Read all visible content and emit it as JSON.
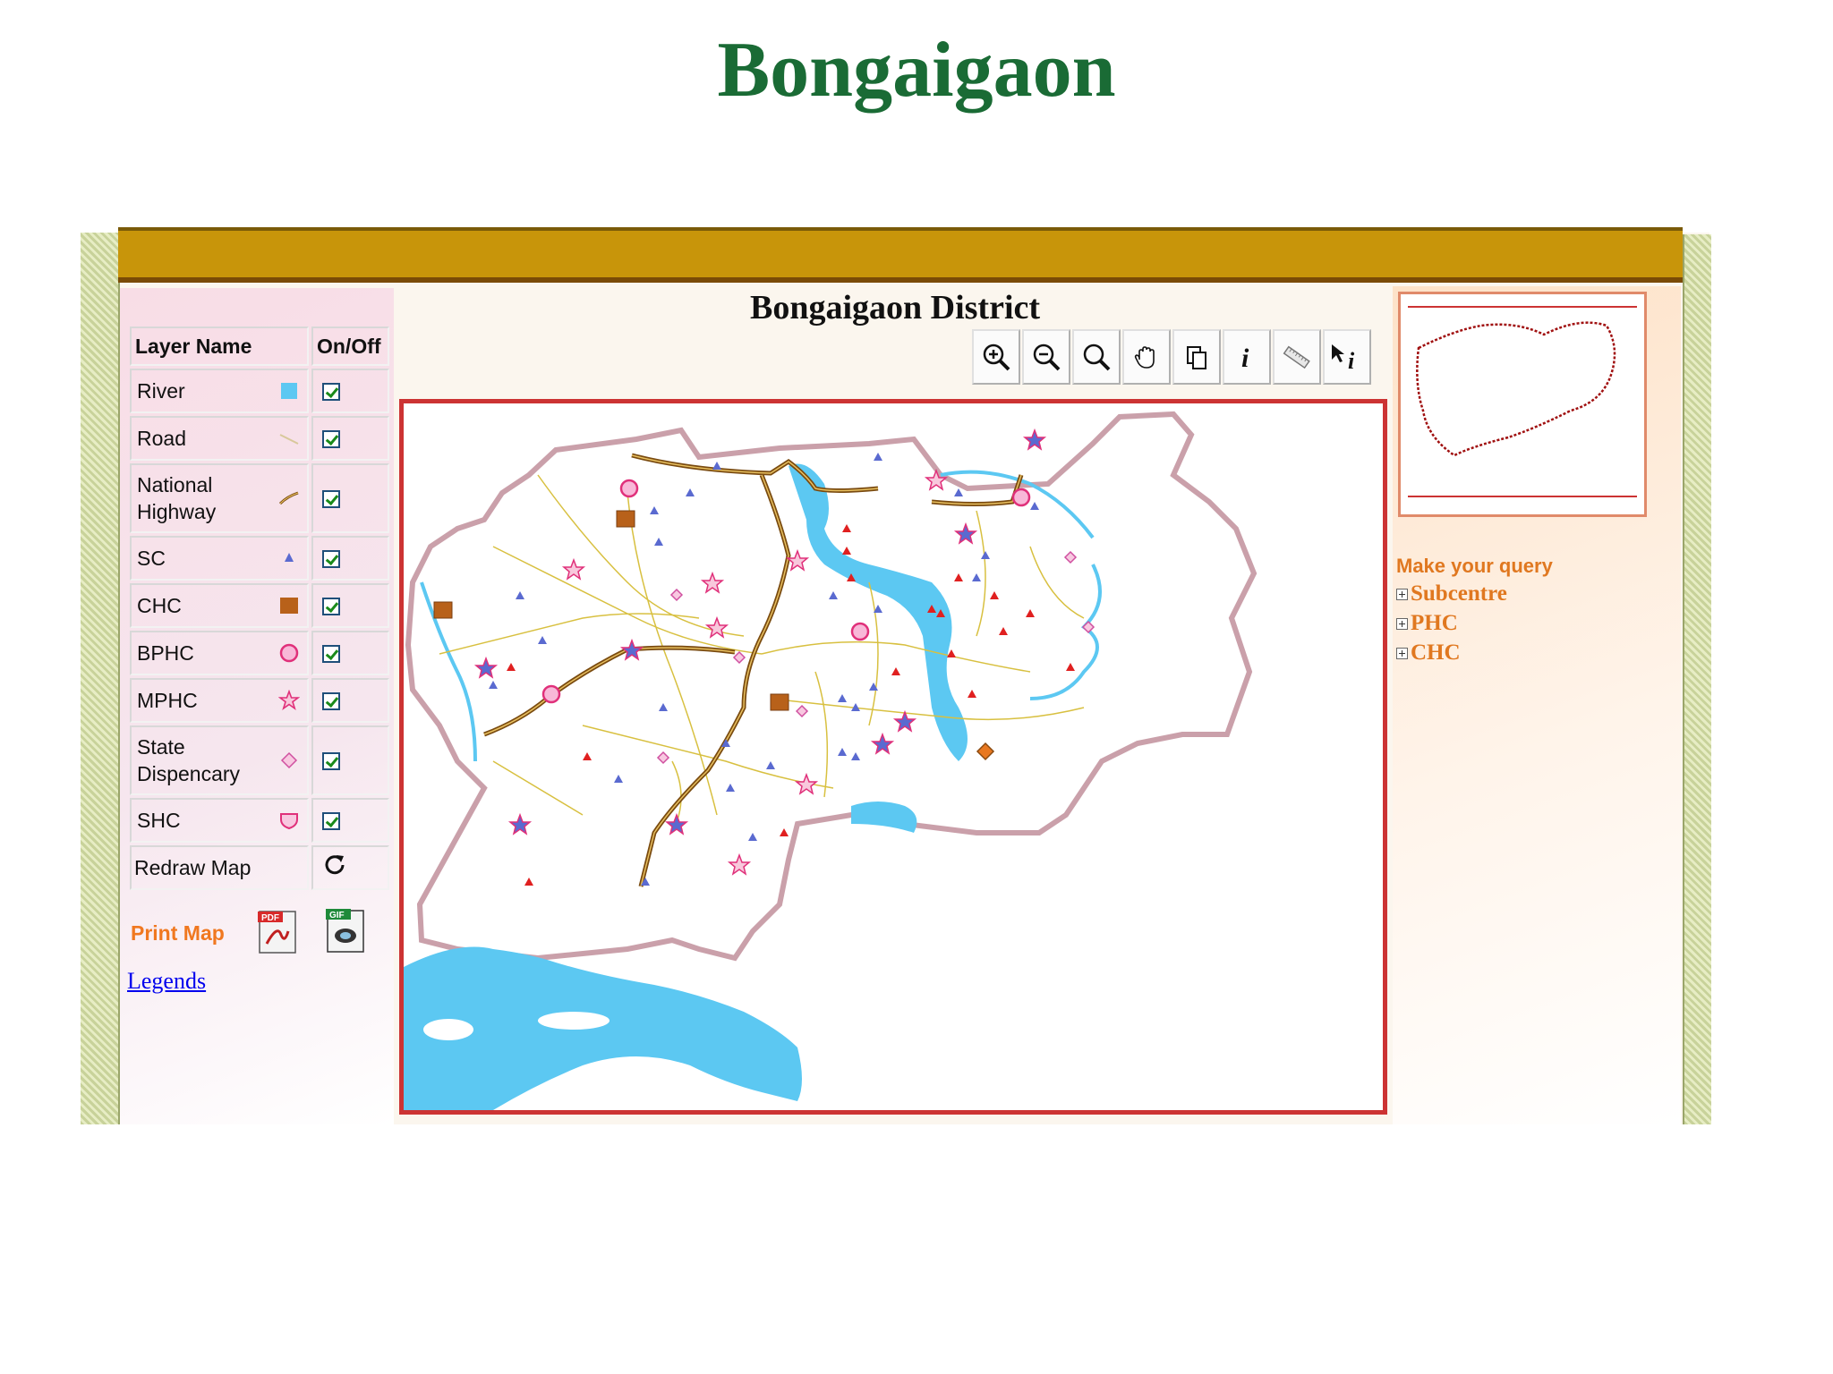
{
  "slide_title": "Bongaigaon",
  "map_title": "Bongaigaon District",
  "layer_table": {
    "header_name": "Layer Name",
    "header_toggle": "On/Off",
    "layers": [
      {
        "name": "River",
        "symbol": "river-swatch",
        "checked": true
      },
      {
        "name": "Road",
        "symbol": "road-line",
        "checked": true
      },
      {
        "name": "National Highway",
        "symbol": "highway-line",
        "checked": true
      },
      {
        "name": "SC",
        "symbol": "triangle",
        "checked": true
      },
      {
        "name": "CHC",
        "symbol": "brown-square",
        "checked": true
      },
      {
        "name": "BPHC",
        "symbol": "pink-circle",
        "checked": true
      },
      {
        "name": "MPHC",
        "symbol": "pink-star",
        "checked": true
      },
      {
        "name": "State Dispencary",
        "symbol": "pink-diamond",
        "checked": true
      },
      {
        "name": "SHC",
        "symbol": "pink-shield",
        "checked": true
      }
    ],
    "redraw_label": "Redraw Map"
  },
  "print_map_label": "Print Map",
  "pdf_badge": "PDF",
  "gif_badge": "GIF",
  "legends_link": "Legends",
  "toolbar": [
    "zoom-in-icon",
    "zoom-out-icon",
    "zoom-full-icon",
    "pan-hand-icon",
    "copy-icon",
    "info-icon",
    "measure-ruler-icon",
    "select-info-icon"
  ],
  "query": {
    "title": "Make your query",
    "items": [
      "Subcentre",
      "PHC",
      "CHC"
    ]
  },
  "colors": {
    "title_green": "#1a6b35",
    "top_bar": "#c8950a",
    "map_border": "#cc3333",
    "river": "#5cc8f2",
    "boundary": "#caa0aa",
    "road": "#d8c040",
    "highway": "#7a4b10",
    "query_orange": "#e07820"
  }
}
